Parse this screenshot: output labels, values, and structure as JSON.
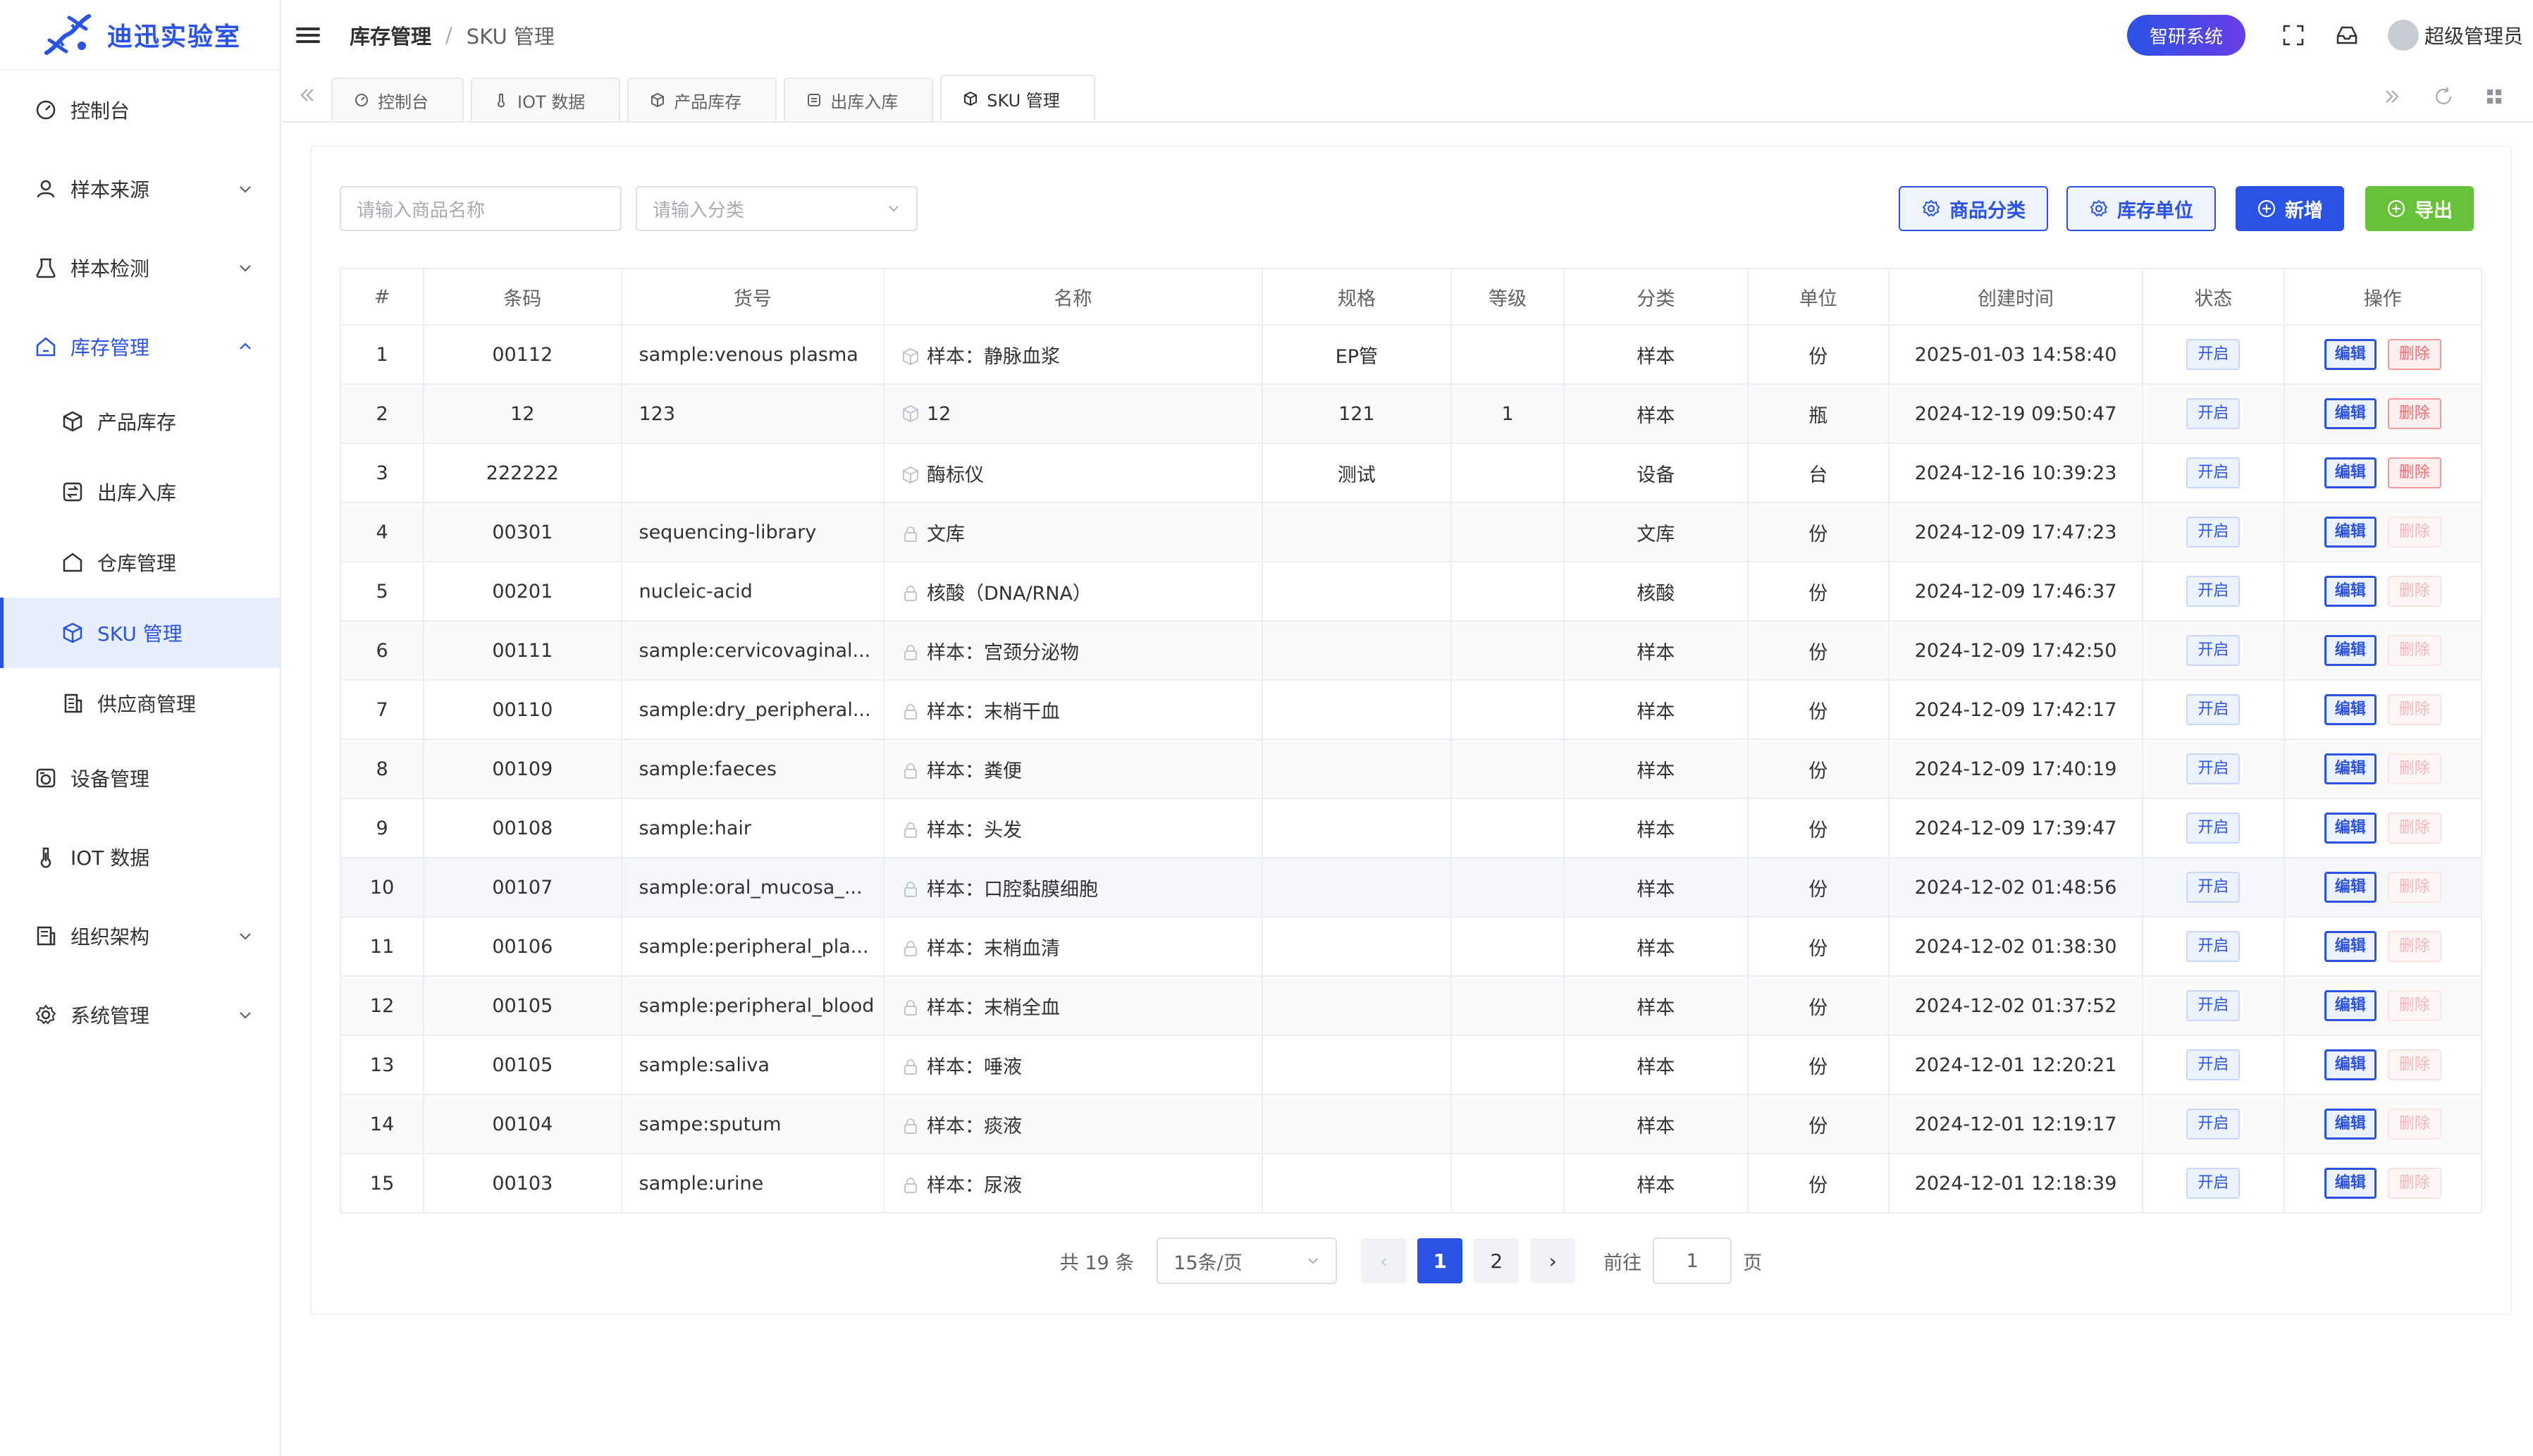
{
  "app": {
    "title": "迪迅实验室"
  },
  "colors": {
    "accent": "#2a53e6",
    "success": "#67c23a",
    "danger": "#f56c6c"
  },
  "sidebar": {
    "items": [
      {
        "label": "控制台",
        "icon": "dashboard-icon"
      },
      {
        "label": "样本来源",
        "icon": "user-icon",
        "expandable": true
      },
      {
        "label": "样本检测",
        "icon": "test-icon",
        "expandable": true
      },
      {
        "label": "库存管理",
        "icon": "home-icon",
        "expandable": true,
        "expanded": true
      },
      {
        "label": "设备管理",
        "icon": "device-icon"
      },
      {
        "label": "IOT 数据",
        "icon": "thermometer-icon"
      },
      {
        "label": "组织架构",
        "icon": "org-icon",
        "expandable": true
      },
      {
        "label": "系统管理",
        "icon": "gear-icon",
        "expandable": true
      }
    ],
    "sub_items": [
      {
        "label": "产品库存",
        "icon": "box-icon"
      },
      {
        "label": "出库入库",
        "icon": "exchange-icon"
      },
      {
        "label": "仓库管理",
        "icon": "warehouse-icon"
      },
      {
        "label": "SKU 管理",
        "icon": "box-icon",
        "active": true
      },
      {
        "label": "供应商管理",
        "icon": "building-icon"
      }
    ]
  },
  "header": {
    "breadcrumb": [
      "库存管理",
      "/",
      "SKU 管理"
    ],
    "system_button": "智研系统",
    "user_name": "超级管理员"
  },
  "tabs": [
    {
      "label": "控制台",
      "icon": "dashboard-icon"
    },
    {
      "label": "IOT 数据",
      "icon": "thermometer-icon"
    },
    {
      "label": "产品库存",
      "icon": "box-icon"
    },
    {
      "label": "出库入库",
      "icon": "exchange-icon"
    },
    {
      "label": "SKU 管理",
      "icon": "box-icon",
      "active": true
    }
  ],
  "toolbar": {
    "name_placeholder": "请输入商品名称",
    "category_placeholder": "请输入分类",
    "category_btn": "商品分类",
    "unit_btn": "库存单位",
    "add_btn": "新增",
    "export_btn": "导出"
  },
  "table": {
    "columns": [
      "#",
      "条码",
      "货号",
      "名称",
      "规格",
      "等级",
      "分类",
      "单位",
      "创建时间",
      "状态",
      "操作"
    ],
    "edit_label": "编辑",
    "delete_label": "删除",
    "rows": [
      {
        "no": "1",
        "barcode": "00112",
        "code": "sample:venous plasma",
        "name": "样本：静脉血浆",
        "spec": "EP管",
        "grade": "",
        "category": "样本",
        "unit": "份",
        "created": "2025-01-03 14:58:40",
        "status": "开启",
        "deletable": true
      },
      {
        "no": "2",
        "barcode": "12",
        "code": "123",
        "name": "12",
        "spec": "121",
        "grade": "1",
        "category": "样本",
        "unit": "瓶",
        "created": "2024-12-19 09:50:47",
        "status": "开启",
        "deletable": true
      },
      {
        "no": "3",
        "barcode": "222222",
        "code": "",
        "name": "酶标仪",
        "spec": "测试",
        "grade": "",
        "category": "设备",
        "unit": "台",
        "created": "2024-12-16 10:39:23",
        "status": "开启",
        "deletable": true
      },
      {
        "no": "4",
        "barcode": "00301",
        "code": "sequencing-library",
        "name": "文库",
        "spec": "",
        "grade": "",
        "category": "文库",
        "unit": "份",
        "created": "2024-12-09 17:47:23",
        "status": "开启",
        "deletable": false
      },
      {
        "no": "5",
        "barcode": "00201",
        "code": "nucleic-acid",
        "name": "核酸（DNA/RNA）",
        "spec": "",
        "grade": "",
        "category": "核酸",
        "unit": "份",
        "created": "2024-12-09 17:46:37",
        "status": "开启",
        "deletable": false
      },
      {
        "no": "6",
        "barcode": "00111",
        "code": "sample:cervicovaginal...",
        "name": "样本：宫颈分泌物",
        "spec": "",
        "grade": "",
        "category": "样本",
        "unit": "份",
        "created": "2024-12-09 17:42:50",
        "status": "开启",
        "deletable": false
      },
      {
        "no": "7",
        "barcode": "00110",
        "code": "sample:dry_peripheral...",
        "name": "样本：末梢干血",
        "spec": "",
        "grade": "",
        "category": "样本",
        "unit": "份",
        "created": "2024-12-09 17:42:17",
        "status": "开启",
        "deletable": false
      },
      {
        "no": "8",
        "barcode": "00109",
        "code": "sample:faeces",
        "name": "样本：粪便",
        "spec": "",
        "grade": "",
        "category": "样本",
        "unit": "份",
        "created": "2024-12-09 17:40:19",
        "status": "开启",
        "deletable": false
      },
      {
        "no": "9",
        "barcode": "00108",
        "code": "sample:hair",
        "name": "样本：头发",
        "spec": "",
        "grade": "",
        "category": "样本",
        "unit": "份",
        "created": "2024-12-09 17:39:47",
        "status": "开启",
        "deletable": false
      },
      {
        "no": "10",
        "barcode": "00107",
        "code": "sample:oral_mucosa_...",
        "name": "样本：口腔黏膜细胞",
        "spec": "",
        "grade": "",
        "category": "样本",
        "unit": "份",
        "created": "2024-12-02 01:48:56",
        "status": "开启",
        "deletable": false
      },
      {
        "no": "11",
        "barcode": "00106",
        "code": "sample:peripheral_pla...",
        "name": "样本：末梢血清",
        "spec": "",
        "grade": "",
        "category": "样本",
        "unit": "份",
        "created": "2024-12-02 01:38:30",
        "status": "开启",
        "deletable": false
      },
      {
        "no": "12",
        "barcode": "00105",
        "code": "sample:peripheral_blood",
        "name": "样本：末梢全血",
        "spec": "",
        "grade": "",
        "category": "样本",
        "unit": "份",
        "created": "2024-12-02 01:37:52",
        "status": "开启",
        "deletable": false
      },
      {
        "no": "13",
        "barcode": "00105",
        "code": "sample:saliva",
        "name": "样本：唾液",
        "spec": "",
        "grade": "",
        "category": "样本",
        "unit": "份",
        "created": "2024-12-01 12:20:21",
        "status": "开启",
        "deletable": false
      },
      {
        "no": "14",
        "barcode": "00104",
        "code": "sampe:sputum",
        "name": "样本：痰液",
        "spec": "",
        "grade": "",
        "category": "样本",
        "unit": "份",
        "created": "2024-12-01 12:19:17",
        "status": "开启",
        "deletable": false
      },
      {
        "no": "15",
        "barcode": "00103",
        "code": "sample:urine",
        "name": "样本：尿液",
        "spec": "",
        "grade": "",
        "category": "样本",
        "unit": "份",
        "created": "2024-12-01 12:18:39",
        "status": "开启",
        "deletable": false
      }
    ]
  },
  "pagination": {
    "total": "共 19 条",
    "page_size": "15条/页",
    "prev": "‹",
    "pages": [
      "1",
      "2"
    ],
    "current": "1",
    "next": "›",
    "goto_label": "前往",
    "goto_value": "1",
    "page_suffix": "页"
  }
}
